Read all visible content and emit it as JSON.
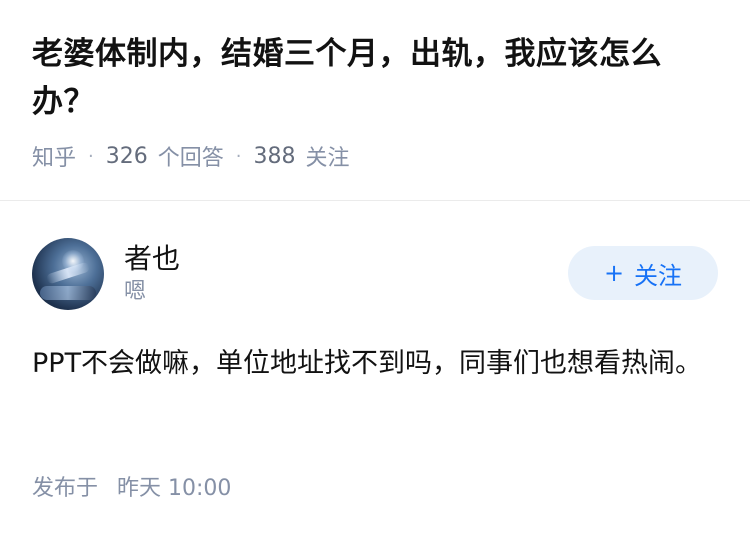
{
  "question": {
    "title": "老婆体制内，结婚三个月，出轨，我应该怎么办？",
    "source": "知乎",
    "separator": "·",
    "answer_count": "326",
    "answer_label": "个回答",
    "follower_count": "388",
    "follower_label": "关注"
  },
  "answer": {
    "author_name": "者也",
    "author_bio": "嗯",
    "follow_label": "关注",
    "follow_icon": "+",
    "content": "PPT不会做嘛，单位地址找不到吗，同事们也想看热闹。",
    "published_label": "发布于",
    "published_time": "昨天 10:00"
  },
  "colors": {
    "accent": "#1772f6",
    "follow_bg": "#e8f1fb",
    "meta": "#8590a6",
    "text": "#121212"
  }
}
